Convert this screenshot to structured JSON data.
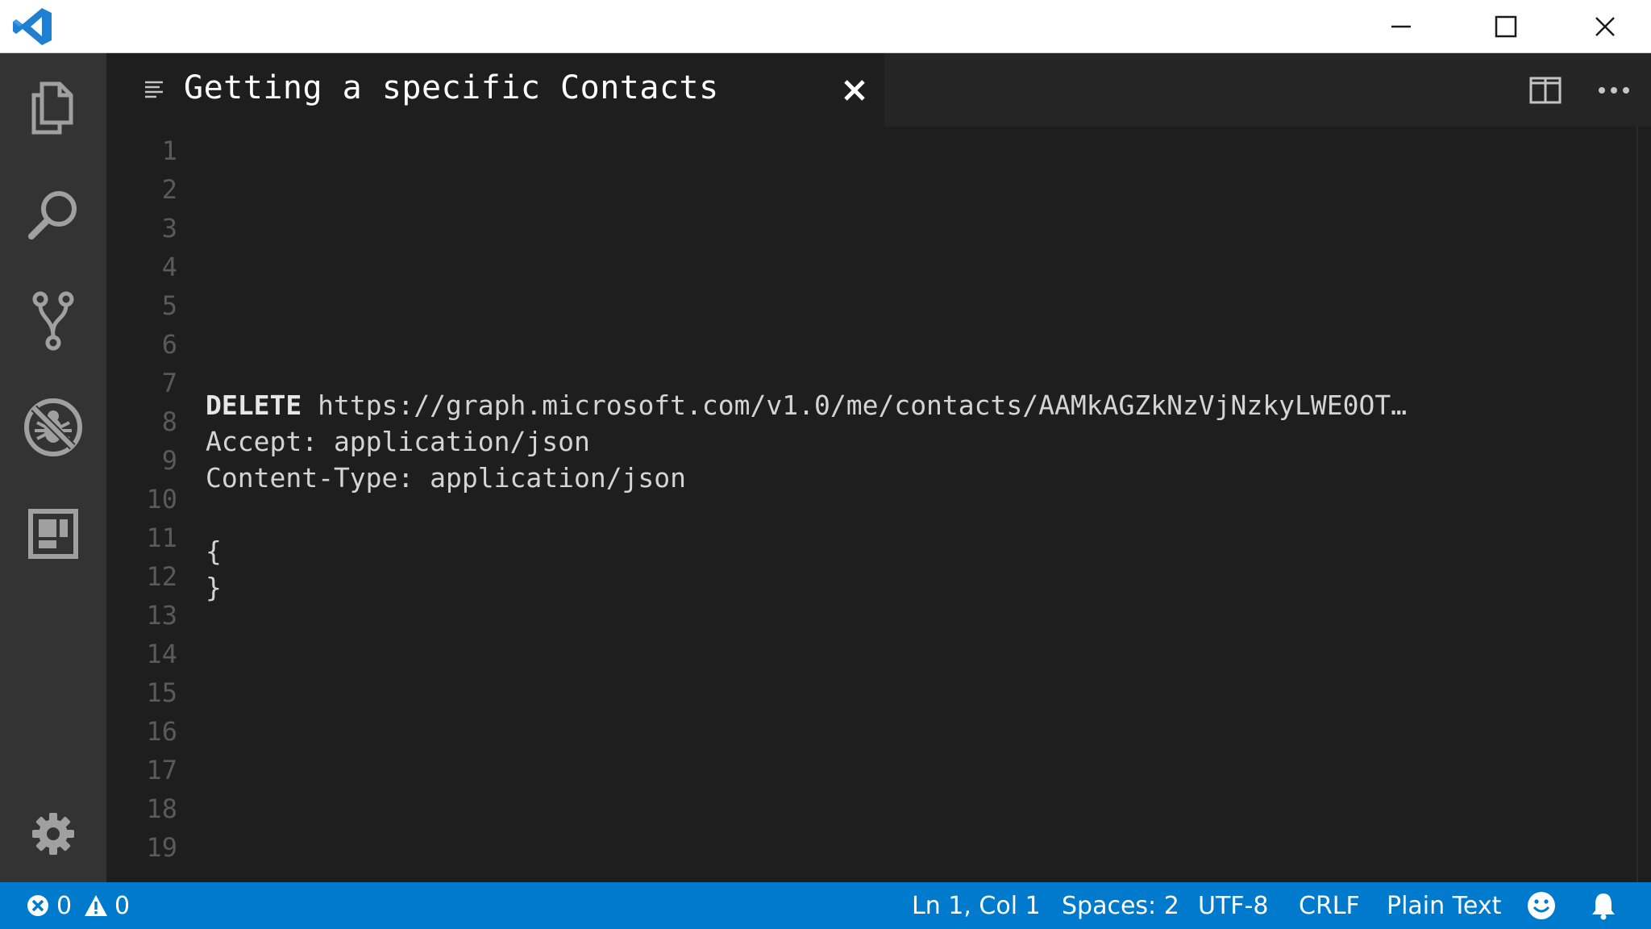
{
  "window": {
    "app_icon": "vscode-logo-icon",
    "controls": {
      "minimize_icon": "minimize-icon",
      "maximize_icon": "maximize-icon",
      "close_icon": "close-icon"
    }
  },
  "activitybar": {
    "items": [
      {
        "name": "explorer",
        "icon": "files-icon"
      },
      {
        "name": "search",
        "icon": "search-icon"
      },
      {
        "name": "source-control",
        "icon": "git-branch-icon"
      },
      {
        "name": "debug",
        "icon": "no-bug-icon"
      },
      {
        "name": "extensions",
        "icon": "extensions-icon"
      }
    ],
    "settings_icon": "gear-icon"
  },
  "tab": {
    "icon": "text-file-icon",
    "label": "Getting a specific Contacts",
    "close_icon": "close-icon"
  },
  "editor_actions": {
    "split_icon": "split-editor-icon",
    "more_icon": "more-ellipsis-icon"
  },
  "editor": {
    "line_numbers": [
      "1",
      "2",
      "3",
      "4",
      "5",
      "6",
      "7",
      "8",
      "9",
      "10",
      "11",
      "12",
      "13",
      "14",
      "15",
      "16",
      "17",
      "18",
      "19"
    ],
    "code": {
      "line8_method": "DELETE",
      "line8_url": " https://graph.microsoft.com/v1.0/me/contacts/AAMkAGZkNzVjNzkyLWE0OT…",
      "line9": "Accept: application/json",
      "line10": "Content-Type: application/json",
      "line12": "{",
      "line13": "}"
    }
  },
  "statusbar": {
    "errors_icon": "error-circle-icon",
    "errors": "0",
    "warnings_icon": "warning-icon",
    "warnings": "0",
    "position": "Ln 1, Col 1",
    "indentation": "Spaces: 2",
    "encoding": "UTF-8",
    "eol": "CRLF",
    "language": "Plain Text",
    "feedback_icon": "smiley-icon",
    "notifications_icon": "bell-icon"
  },
  "colors": {
    "statusbar": "#007acc",
    "editor_bg": "#1e1e1e",
    "activitybar_bg": "#333333",
    "tabstrip_bg": "#252526"
  }
}
